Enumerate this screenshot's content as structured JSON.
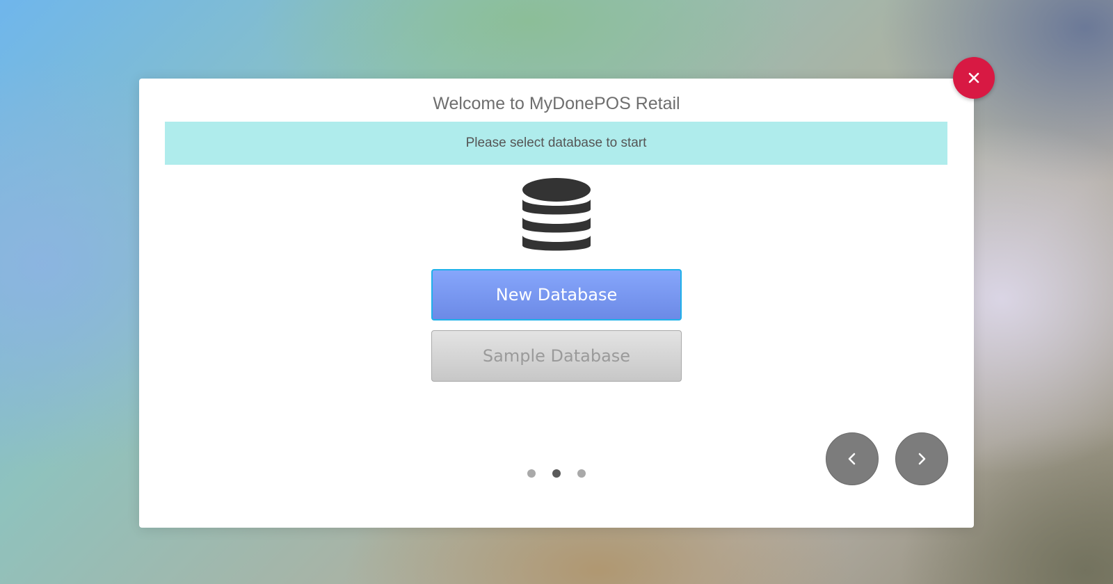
{
  "dialog": {
    "title": "Welcome to MyDonePOS Retail",
    "banner_text": "Please select database to start",
    "database_icon": "database-icon",
    "buttons": {
      "new_database": "New Database",
      "sample_database": "Sample Database"
    },
    "pager": {
      "total_pages": 3,
      "current_page": 2
    },
    "nav": {
      "prev_icon": "chevron-left-icon",
      "next_icon": "chevron-right-icon"
    },
    "close_icon": "close-icon"
  },
  "colors": {
    "close": "#d81943",
    "banner": "#afecec",
    "primary_button": "#7a98f0",
    "primary_button_border": "#1fb1ea",
    "secondary_button": "#d4d4d4",
    "nav_button": "#7c7c7c"
  }
}
